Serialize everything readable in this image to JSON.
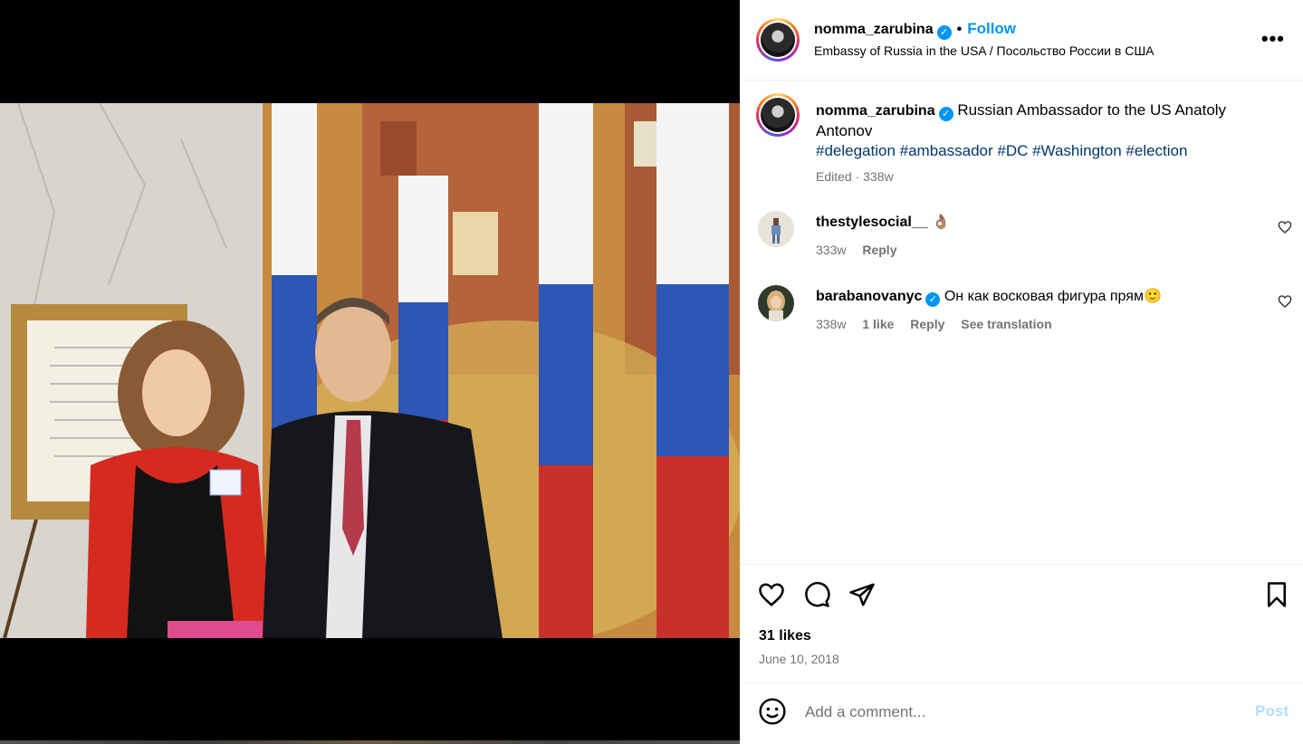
{
  "post": {
    "username": "nomma_zarubina",
    "follow_label": "Follow",
    "location": "Embassy of Russia in the USA / Посольство России в США",
    "more_label": "•••"
  },
  "caption": {
    "username": "nomma_zarubina",
    "text": "Russian Ambassador to the US Anatoly Antonov",
    "hashtags": "#delegation #ambassador #DC #Washington #election",
    "edited": "Edited · 338w"
  },
  "comments": [
    {
      "username": "thestylesocial__",
      "text": "👌🏽",
      "time": "333w",
      "reply_label": "Reply"
    },
    {
      "username": "barabanovanyc",
      "text": "Он как восковая фигура прям🙂",
      "time": "338w",
      "likes": "1 like",
      "reply_label": "Reply",
      "translate_label": "See translation"
    }
  ],
  "stats": {
    "likes": "31 likes",
    "date": "June 10, 2018"
  },
  "composer": {
    "placeholder": "Add a comment...",
    "post_label": "Post"
  },
  "colors": {
    "accent": "#0095f6",
    "hashtag": "#00376b",
    "muted": "#737373"
  }
}
